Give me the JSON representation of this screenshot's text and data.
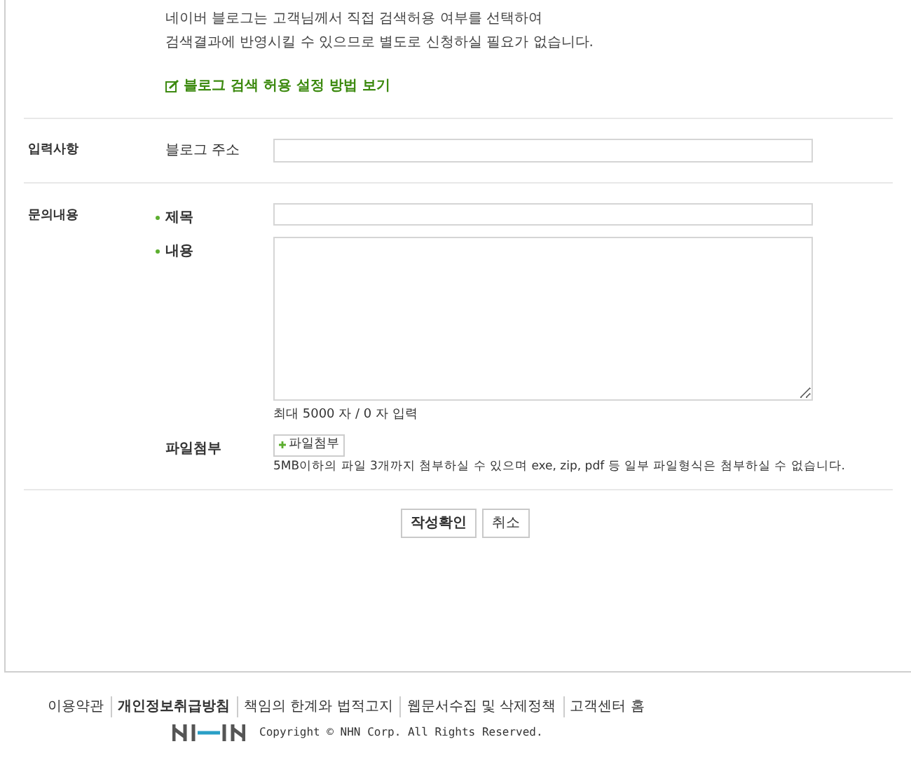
{
  "intro": {
    "lines": [
      "네이버 블로그는 고객님께서 직접 검색허용 여부를 선택하여",
      "검색결과에 반영시킬 수 있으므로 별도로 신청하실 필요가 없습니다."
    ],
    "link": "블로그 검색 허용 설정 방법 보기"
  },
  "input_section": {
    "heading": "입력사항",
    "label": "블로그 주소"
  },
  "inquiry_section": {
    "heading": "문의내용",
    "title_label": "제목",
    "content_label": "내용",
    "counter": "최대 5000 자 / 0 자 입력",
    "attach_label": "파일첨부",
    "attach_button": "파일첨부",
    "attach_note": "5MB이하의 파일 3개까지 첨부하실 수 있으며 exe, zip, pdf 등 일부 파일형식은 첨부하실 수 없습니다."
  },
  "buttons": [
    "작성확인",
    "취소"
  ],
  "footer": {
    "links": [
      {
        "label": "이용약관",
        "bold": false
      },
      {
        "label": "개인정보취급방침",
        "bold": true
      },
      {
        "label": "책임의 한계와 법적고지",
        "bold": false
      },
      {
        "label": "웹문서수집 및 삭제정책",
        "bold": false
      },
      {
        "label": "고객센터 홈",
        "bold": false
      }
    ],
    "copyright": "Copyright © NHN Corp. All Rights Reserved."
  }
}
